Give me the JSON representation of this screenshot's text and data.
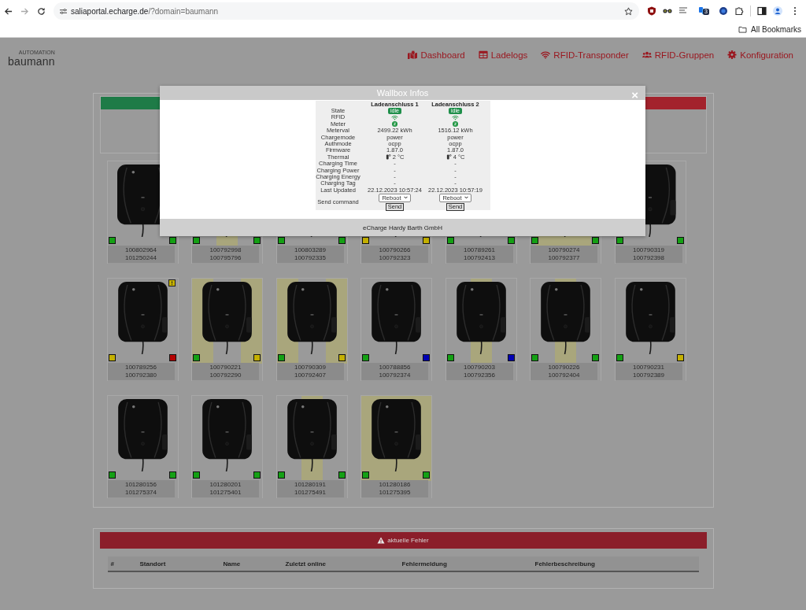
{
  "browser": {
    "url_host": "saliaportal.echarge.de",
    "url_path": "/?domain=baumann",
    "extension_badge": "3",
    "bookmarks": "All Bookmarks"
  },
  "header": {
    "logo_tagline": "AUTOMATION",
    "logo": "baumann",
    "nav": [
      {
        "label": "Dashboard",
        "kind": "map"
      },
      {
        "label": "Ladelogs",
        "kind": "table"
      },
      {
        "label": "RFID-Transponder",
        "kind": "wifi"
      },
      {
        "label": "RFID-Gruppen",
        "kind": "users"
      },
      {
        "label": "Konfiguration",
        "kind": "gear"
      }
    ]
  },
  "overview": {
    "status_bar": [
      {
        "color": "#1e7b47"
      },
      {
        "color": "#a3222c"
      }
    ]
  },
  "wallboxes": [
    {
      "serials": [
        "100802964",
        "101250244"
      ],
      "ports": [
        {
          "color": "#14a014"
        },
        {
          "color": "#14a014"
        }
      ],
      "warning": false,
      "kind": "plain"
    },
    {
      "serials": [
        "100792998",
        "100795796"
      ],
      "ports": [
        {
          "color": "#14a014"
        },
        {
          "color": "#14a014"
        }
      ],
      "warning": false,
      "kind": "center"
    },
    {
      "serials": [
        "100803289",
        "100792335"
      ],
      "ports": [
        {
          "color": "#14a014"
        },
        {
          "color": "#14a014"
        }
      ],
      "warning": false,
      "kind": "plain"
    },
    {
      "serials": [
        "100790266",
        "100792323"
      ],
      "ports": [
        {
          "color": "#c4b000"
        },
        {
          "color": "#c4b000"
        }
      ],
      "warning": false,
      "kind": "plain"
    },
    {
      "serials": [
        "100789261",
        "100792413"
      ],
      "ports": [
        {
          "color": "#14a014"
        },
        {
          "color": "#14a014"
        }
      ],
      "warning": false,
      "kind": "plain"
    },
    {
      "serials": [
        "100790274",
        "100792377"
      ],
      "ports": [
        {
          "color": "#14a014"
        },
        {
          "color": "#14a014"
        }
      ],
      "warning": false,
      "kind": "wide"
    },
    {
      "serials": [
        "100790319",
        "100792398"
      ],
      "ports": [
        {
          "color": "#14a014"
        },
        {
          "color": "#14a014"
        }
      ],
      "warning": false,
      "kind": "plain"
    },
    {
      "serials": [
        "100789256",
        "100792380"
      ],
      "ports": [
        {
          "color": "#c4b000"
        },
        {
          "color": "#b40000"
        }
      ],
      "warning": true,
      "kind": "plain"
    },
    {
      "serials": [
        "100790221",
        "100792290"
      ],
      "ports": [
        {
          "color": "#14a014"
        },
        {
          "color": "#c4b000"
        }
      ],
      "warning": false,
      "kind": "sides"
    },
    {
      "serials": [
        "100790309",
        "100792407"
      ],
      "ports": [
        {
          "color": "#14a014"
        },
        {
          "color": "#c4b000"
        }
      ],
      "warning": false,
      "kind": "sides"
    },
    {
      "serials": [
        "100788856",
        "100792374"
      ],
      "ports": [
        {
          "color": "#14a014"
        },
        {
          "color": "#0000b4"
        }
      ],
      "warning": false,
      "kind": "plain"
    },
    {
      "serials": [
        "100790203",
        "100792356"
      ],
      "ports": [
        {
          "color": "#14a014"
        },
        {
          "color": "#0000b4"
        }
      ],
      "warning": false,
      "kind": "center"
    },
    {
      "serials": [
        "100790226",
        "100792404"
      ],
      "ports": [
        {
          "color": "#14a014"
        },
        {
          "color": "#14a014"
        }
      ],
      "warning": false,
      "kind": "center"
    },
    {
      "serials": [
        "100790231",
        "100792389"
      ],
      "ports": [
        {
          "color": "#14a014"
        },
        {
          "color": "#c4b000"
        }
      ],
      "warning": false,
      "kind": "plain"
    },
    {
      "serials": [
        "101280156",
        "101275374"
      ],
      "ports": [
        {
          "color": "#14a014"
        },
        {
          "color": "#14a014"
        }
      ],
      "warning": false,
      "kind": "plain"
    },
    {
      "serials": [
        "101280201",
        "101275401"
      ],
      "ports": [
        {
          "color": "#14a014"
        },
        {
          "color": "#14a014"
        }
      ],
      "warning": false,
      "kind": "plain"
    },
    {
      "serials": [
        "101280191",
        "101275491"
      ],
      "ports": [
        {
          "color": "#14a014"
        },
        {
          "color": "#14a014"
        }
      ],
      "warning": false,
      "kind": "center"
    },
    {
      "serials": [
        "101280186",
        "101275395"
      ],
      "ports": [
        {
          "color": "#14a014"
        },
        {
          "color": "#14a014"
        }
      ],
      "warning": false,
      "kind": "full"
    }
  ],
  "modal": {
    "title": "Wallbox Infos",
    "close": "×",
    "columns": [
      "Ladeanschluss 1",
      "Ladeanschluss 2"
    ],
    "rows": [
      {
        "label": "State",
        "kind": "badge",
        "values": [
          "idle",
          "idle"
        ]
      },
      {
        "label": "RFID",
        "kind": "wifi"
      },
      {
        "label": "Meter",
        "kind": "meter"
      },
      {
        "label": "Meterval",
        "kind": "text",
        "values": [
          "2499.22 kWh",
          "1516.12 kWh"
        ]
      },
      {
        "label": "Chargemode",
        "kind": "text",
        "values": [
          "power",
          "power"
        ]
      },
      {
        "label": "Authmode",
        "kind": "text",
        "values": [
          "ocpp",
          "ocpp"
        ]
      },
      {
        "label": "Firmware",
        "kind": "text",
        "values": [
          "1.87.0",
          "1.87.0"
        ]
      },
      {
        "label": "Thermal",
        "kind": "thermal",
        "values": [
          "2 °C",
          "4 °C"
        ]
      },
      {
        "label": "Charging Time",
        "kind": "text",
        "values": [
          "-",
          "-"
        ]
      },
      {
        "label": "Charging Power",
        "kind": "text",
        "values": [
          "-",
          "-"
        ]
      },
      {
        "label": "Charging Energy",
        "kind": "text",
        "values": [
          "-",
          "-"
        ]
      },
      {
        "label": "Charging Tag",
        "kind": "text",
        "values": [
          "-",
          "-"
        ]
      },
      {
        "label": "Last Updated",
        "kind": "text",
        "values": [
          "22.12.2023 10:57:24",
          "22.12.2023 10:57:19"
        ]
      },
      {
        "label": "Send command",
        "kind": "command",
        "values": [
          "Reboot",
          "Reboot"
        ],
        "buttons": [
          "Send",
          "Send"
        ]
      }
    ],
    "footer": "eCharge Hardy Barth GmbH"
  },
  "errors": {
    "title": "aktuelle Fehler",
    "columns": [
      "#",
      "Standort",
      "Name",
      "Zuletzt online",
      "Fehlermeldung",
      "Fehlerbeschreibung"
    ]
  }
}
